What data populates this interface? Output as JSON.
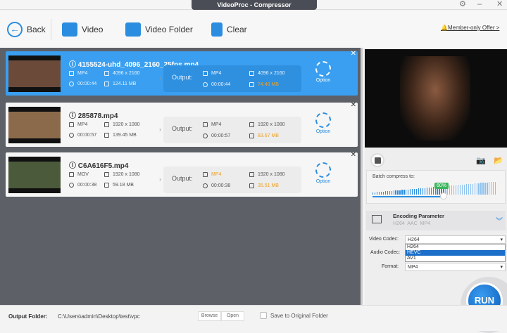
{
  "window": {
    "title": "VideoProc - Compressor"
  },
  "toolbar": {
    "back": "Back",
    "video": "Video",
    "video_folder": "Video Folder",
    "clear": "Clear",
    "offer": "Member-only Offer >"
  },
  "output_label": "Output:",
  "option_label": "Option",
  "files": [
    {
      "name": "4155524-uhd_4096_2160_25fps.mp4",
      "format": "MP4",
      "resolution": "4096 x 2160",
      "duration": "00:00:44",
      "size": "124.11 MB",
      "out_format": "MP4",
      "out_resolution": "4096 x 2160",
      "out_duration": "00:00:44",
      "out_size": "74.46 MB",
      "selected": true
    },
    {
      "name": "285878.mp4",
      "format": "MP4",
      "resolution": "1920 x 1080",
      "duration": "00:00:57",
      "size": "139.45 MB",
      "out_format": "MP4",
      "out_resolution": "1920 x 1080",
      "out_duration": "00:00:57",
      "out_size": "83.67 MB",
      "selected": false
    },
    {
      "name": "C6A616F5.mp4",
      "format": "MOV",
      "resolution": "1920 x 1080",
      "duration": "00:00:38",
      "size": "59.18 MB",
      "out_format": "MP4",
      "out_resolution": "1920 x 1080",
      "out_duration": "00:00:38",
      "out_size": "35.51 MB",
      "selected": false
    }
  ],
  "compress": {
    "label": "Batch compress to:",
    "value_label": "60%",
    "value": 60
  },
  "encoding": {
    "title": "Encoding Parameter",
    "summary": "H264  AAC  MP4",
    "video_codec_label": "Video Codec:",
    "video_codec": "H264",
    "audio_codec_label": "Audio Codec:",
    "format_label": "Format:",
    "format": "MP4",
    "codec_options": [
      "H264",
      "HEVC",
      "AV1"
    ],
    "highlighted": "HEVC"
  },
  "run": "RUN",
  "bottom": {
    "output_folder_label": "Output Folder:",
    "path": "C:\\Users\\admin\\Desktop\\test\\vpc",
    "browse": "Browse",
    "open": "Open",
    "save_original": "Save to Original Folder"
  }
}
